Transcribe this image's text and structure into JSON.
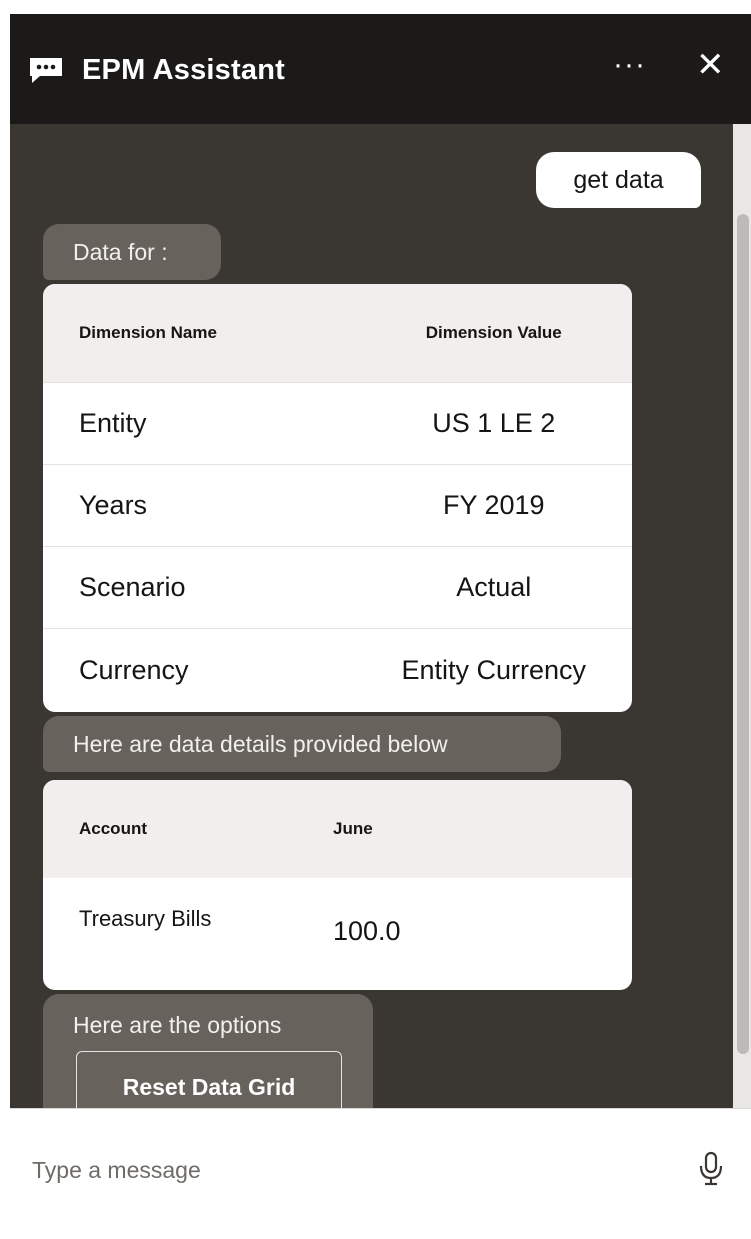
{
  "header": {
    "title": "EPM Assistant",
    "more_label": "···",
    "close_label": "✕"
  },
  "messages": {
    "user_message": "get data",
    "data_for_label": "Data for :",
    "data_details_label": "Here are data details provided below",
    "options_label": "Here are the options"
  },
  "dimension_table": {
    "headers": [
      "Dimension Name",
      "Dimension Value"
    ],
    "rows": [
      [
        "Entity",
        "US 1 LE 2"
      ],
      [
        "Years",
        "FY 2019"
      ],
      [
        "Scenario",
        "Actual"
      ],
      [
        "Currency",
        "Entity Currency"
      ]
    ]
  },
  "data_table": {
    "headers": [
      "Account",
      "June"
    ],
    "rows": [
      [
        "Treasury Bills",
        "100.0"
      ]
    ]
  },
  "options": {
    "reset_button": "Reset Data Grid"
  },
  "input": {
    "placeholder": "Type a message"
  },
  "colors": {
    "header_bg": "#1b1a19",
    "chat_bg": "#3a3632",
    "bot_bubble": "#67625c",
    "user_bubble": "#ffffff"
  }
}
